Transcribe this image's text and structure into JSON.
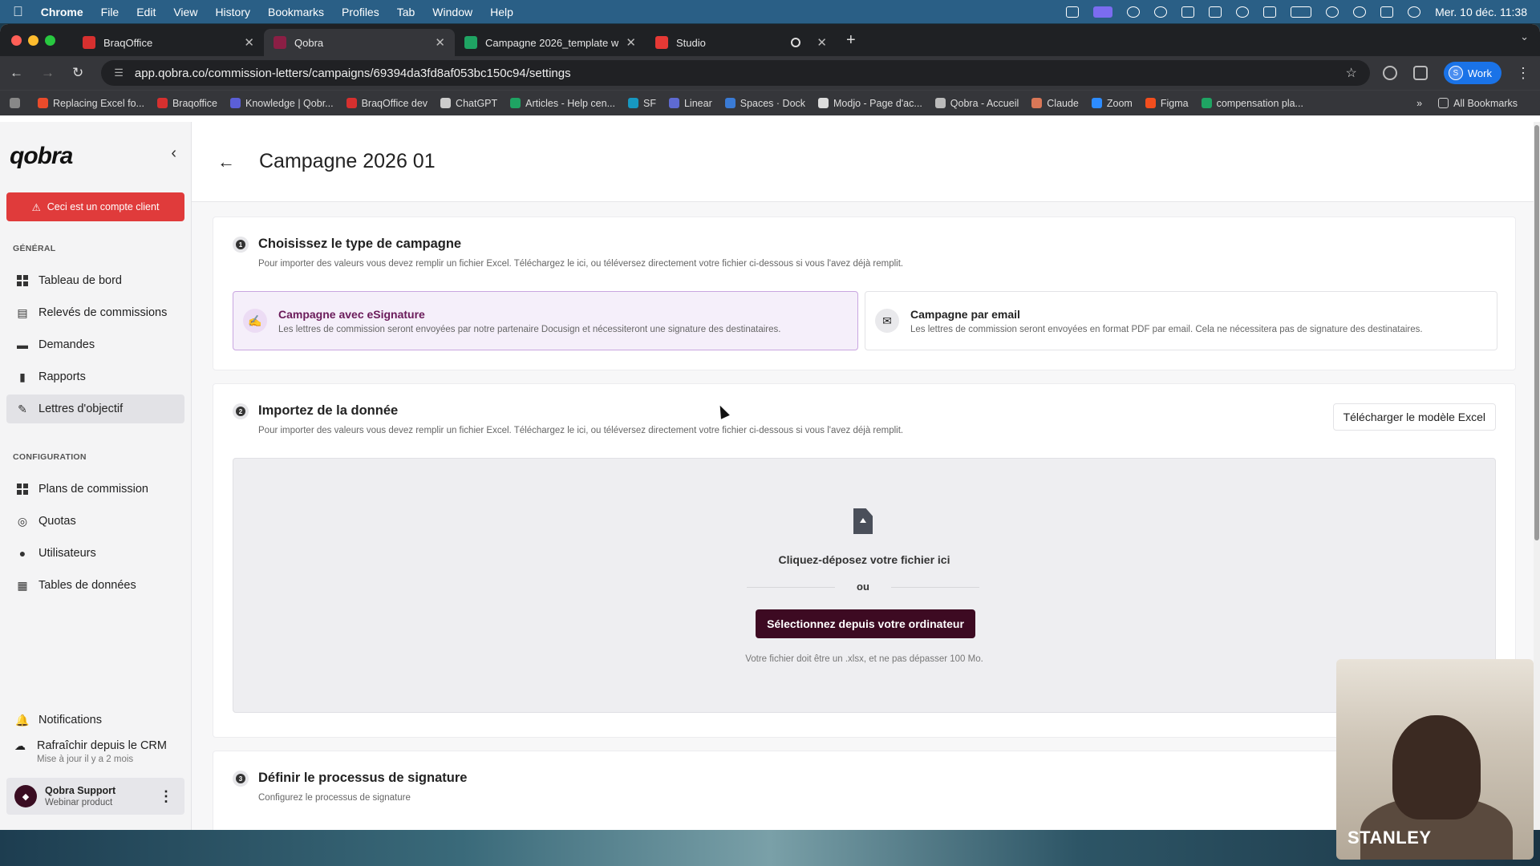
{
  "menubar": {
    "app": "Chrome",
    "items": [
      "File",
      "Edit",
      "View",
      "History",
      "Bookmarks",
      "Profiles",
      "Tab",
      "Window",
      "Help"
    ],
    "datetime": "Mer. 10 déc. 11:38"
  },
  "browser": {
    "tabs": [
      {
        "title": "BraqOffice",
        "favicon_color": "#d6302f"
      },
      {
        "title": "Qobra",
        "favicon_color": "#8b1f45"
      },
      {
        "title": "Campagne 2026_template w",
        "favicon_color": "#1fa463"
      },
      {
        "title": "Studio",
        "favicon_color": "#e53935"
      }
    ],
    "url": "app.qobra.co/commission-letters/campaigns/69394da3fd8af053bc150c94/settings",
    "profile": "Work",
    "profile_initial": "S",
    "bookmarks": [
      {
        "label": "Replacing Excel fo...",
        "color": "#e94b2b"
      },
      {
        "label": "Braqoffice",
        "color": "#d6302f"
      },
      {
        "label": "Knowledge | Qobr...",
        "color": "#5b5fd6"
      },
      {
        "label": "BraqOffice dev",
        "color": "#d6302f"
      },
      {
        "label": "ChatGPT",
        "color": "#cccccc"
      },
      {
        "label": "Articles - Help cen...",
        "color": "#1fa463"
      },
      {
        "label": "SF",
        "color": "#1798c1"
      },
      {
        "label": "Linear",
        "color": "#5e6ad2"
      },
      {
        "label": "Spaces · Dock",
        "color": "#3a7bd5"
      },
      {
        "label": "Modjo - Page d'ac...",
        "color": "#dddddd"
      },
      {
        "label": "Qobra - Accueil",
        "color": "#bbbbbb"
      },
      {
        "label": "Claude",
        "color": "#d97757"
      },
      {
        "label": "Zoom",
        "color": "#2d8cff"
      },
      {
        "label": "Figma",
        "color": "#f24e1e"
      },
      {
        "label": "compensation pla...",
        "color": "#1fa463"
      }
    ],
    "all_bookmarks": "All Bookmarks"
  },
  "sidebar": {
    "logo": "qobra",
    "alert": "Ceci est un compte client",
    "section_general": "GÉNÉRAL",
    "general_items": [
      "Tableau de bord",
      "Relevés de commissions",
      "Demandes",
      "Rapports",
      "Lettres d'objectif"
    ],
    "section_config": "CONFIGURATION",
    "config_items": [
      "Plans de commission",
      "Quotas",
      "Utilisateurs",
      "Tables de données"
    ],
    "notifications": "Notifications",
    "refresh_label": "Rafraîchir depuis le CRM",
    "refresh_sub": "Mise à jour il y a 2 mois",
    "user_name": "Qobra Support",
    "user_role": "Webinar product"
  },
  "page": {
    "title": "Campagne 2026 01",
    "step1": {
      "num": "1",
      "title": "Choisissez le type de campagne",
      "subtitle": "Pour importer des valeurs vous devez remplir un fichier Excel. Téléchargez le ici, ou téléversez directement votre fichier ci-dessous si vous l'avez déjà remplit.",
      "options": [
        {
          "title": "Campagne avec eSignature",
          "desc": "Les lettres de commission seront envoyées par notre partenaire Docusign et nécessiteront une signature des destinataires."
        },
        {
          "title": "Campagne par email",
          "desc": "Les lettres de commission seront envoyées en format PDF par email. Cela ne nécessitera pas de signature des destinataires."
        }
      ]
    },
    "step2": {
      "num": "2",
      "title": "Importez de la donnée",
      "subtitle": "Pour importer des valeurs vous devez remplir un fichier Excel. Téléchargez le ici, ou téléversez directement votre fichier ci-dessous si vous l'avez déjà remplit.",
      "download_btn": "Télécharger le modèle Excel",
      "drop_text": "Cliquez-déposez votre fichier ici",
      "or": "ou",
      "select_btn": "Sélectionnez depuis votre ordinateur",
      "hint": "Votre fichier doit être un .xlsx, et ne pas dépasser 100 Mo."
    },
    "step3": {
      "num": "3",
      "title": "Définir le processus de signature",
      "subtitle": "Configurez le processus de signature"
    }
  },
  "webcam": {
    "name": "STANLEY"
  }
}
